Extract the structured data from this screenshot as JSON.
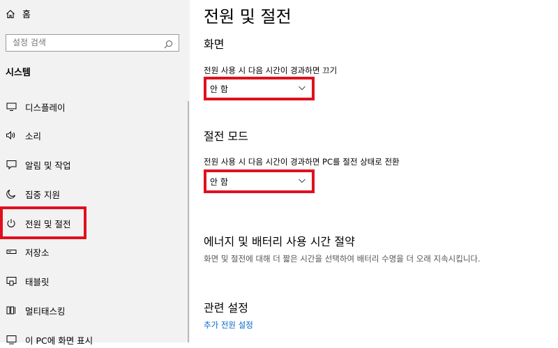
{
  "sidebar": {
    "home_label": "홈",
    "search": {
      "placeholder": "설정 검색",
      "icon": "search-icon"
    },
    "section_heading": "시스템",
    "items": [
      {
        "label": "디스플레이",
        "icon": "display-icon"
      },
      {
        "label": "소리",
        "icon": "speaker-icon"
      },
      {
        "label": "알림 및 작업",
        "icon": "notification-icon"
      },
      {
        "label": "집중 지원",
        "icon": "moon-icon"
      },
      {
        "label": "전원 및 절전",
        "icon": "power-icon",
        "selected": true
      },
      {
        "label": "저장소",
        "icon": "storage-icon"
      },
      {
        "label": "태블릿",
        "icon": "tablet-icon"
      },
      {
        "label": "멀티태스킹",
        "icon": "multitasking-icon"
      },
      {
        "label": "이 PC에 화면 표시",
        "icon": "project-icon"
      }
    ]
  },
  "main": {
    "title": "전원 및 절전",
    "screen": {
      "heading": "화면",
      "label": "전원 사용 시 다음 시간이 경과하면 끄기",
      "value": "안 함"
    },
    "sleep": {
      "heading": "절전 모드",
      "label": "전원 사용 시 다음 시간이 경과하면 PC를 절전 상태로 전환",
      "value": "안 함"
    },
    "energy": {
      "heading": "에너지 및 배터리 사용 시간 절약",
      "description": "화면 및 절전에 대해 더 짧은 시간을 선택하여 배터리 수명을 더 오래 지속시킵니다."
    },
    "related": {
      "heading": "관련 설정",
      "link": "추가 전원 설정"
    }
  },
  "colors": {
    "highlight": "#e0101e",
    "link": "#0064c8",
    "sidebar_bg": "#f2f2f2"
  }
}
